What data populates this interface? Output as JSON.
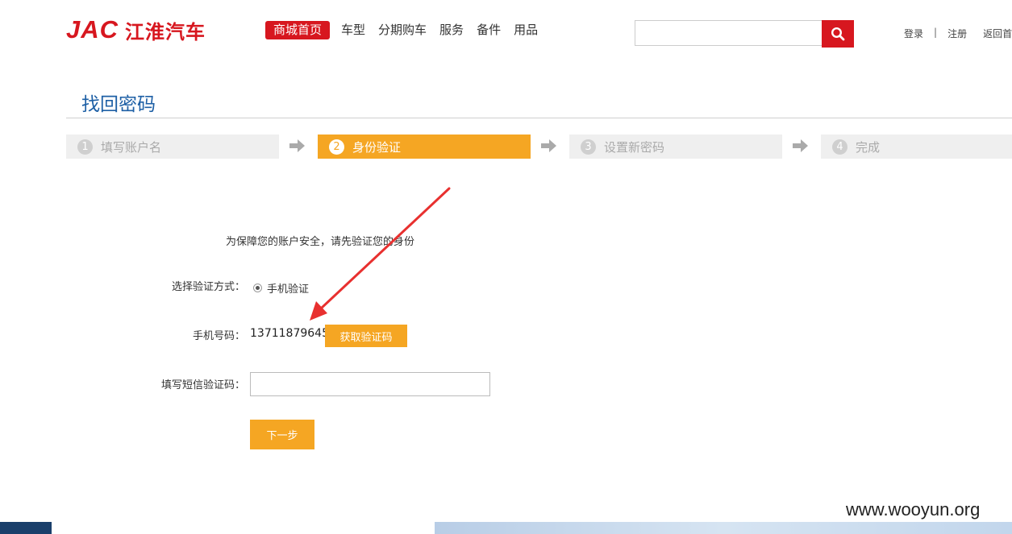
{
  "header": {
    "logo_en": "JAC",
    "logo_cn": "江淮汽车",
    "nav": [
      "商城首页",
      "车型",
      "分期购车",
      "服务",
      "备件",
      "用品"
    ],
    "search_placeholder": "",
    "links": {
      "login": "登录",
      "separator": "|",
      "register": "注册",
      "back_home": "返回首"
    }
  },
  "page": {
    "title": "找回密码",
    "steps": [
      {
        "num": "1",
        "label": "填写账户名"
      },
      {
        "num": "2",
        "label": "身份验证"
      },
      {
        "num": "3",
        "label": "设置新密码"
      },
      {
        "num": "4",
        "label": "完成"
      }
    ],
    "active_step": 2
  },
  "form": {
    "notice": "为保障您的账户安全，请先验证您的身份",
    "method_label": "选择验证方式：",
    "method_option": "手机验证",
    "phone_label": "手机号码：",
    "phone_value": "13711879645",
    "get_code_button": "获取验证码",
    "sms_label": "填写短信验证码：",
    "sms_value": "",
    "next_button": "下一步"
  },
  "watermark": "www.wooyun.org",
  "colors": {
    "brand_red": "#d7171f",
    "accent_orange": "#f5a623",
    "title_blue": "#1d5fa5",
    "annotation_arrow": "#e8302f"
  }
}
